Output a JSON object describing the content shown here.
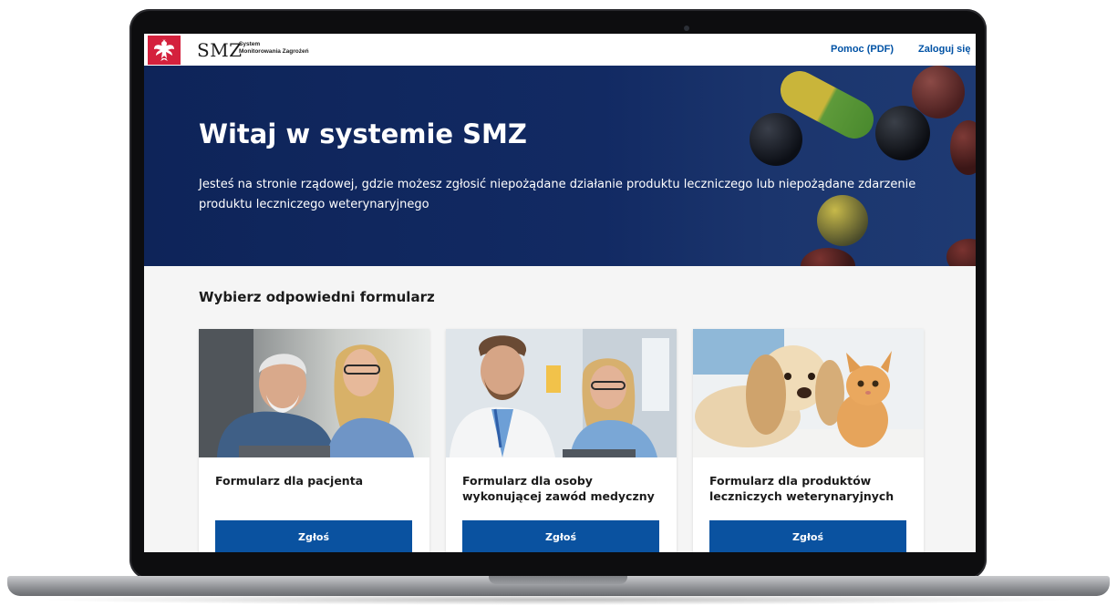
{
  "header": {
    "logo_main": "SMZ",
    "logo_sub_line1": "System",
    "logo_sub_line2": "Monitorowania Zagrożeń",
    "help_link": "Pomoc (PDF)",
    "login_link": "Zaloguj się"
  },
  "hero": {
    "title": "Witaj w systemie SMZ",
    "description": "Jesteś na stronie rządowej, gdzie możesz zgłosić niepożądane działanie produktu leczniczego lub niepożądane zdarzenie produktu leczniczego weterynaryjnego"
  },
  "main": {
    "section_title": "Wybierz odpowiedni formularz",
    "cards": [
      {
        "title": "Formularz dla pacjenta",
        "button": "Zgłoś",
        "image": "elderly-man-with-woman-tablet-photo"
      },
      {
        "title": "Formularz dla osoby wykonującej zawód medyczny",
        "button": "Zgłoś",
        "image": "doctor-and-nurse-photo"
      },
      {
        "title": "Formularz dla produktów leczniczych weterynaryjnych",
        "button": "Zgłoś",
        "image": "puppy-and-kitten-photo"
      }
    ]
  },
  "colors": {
    "primary": "#0a52a0",
    "hero_bg": "#122a63",
    "emblem_red": "#d4213d",
    "link": "#0052a5"
  },
  "icons": [
    "polish-eagle-emblem-icon"
  ]
}
